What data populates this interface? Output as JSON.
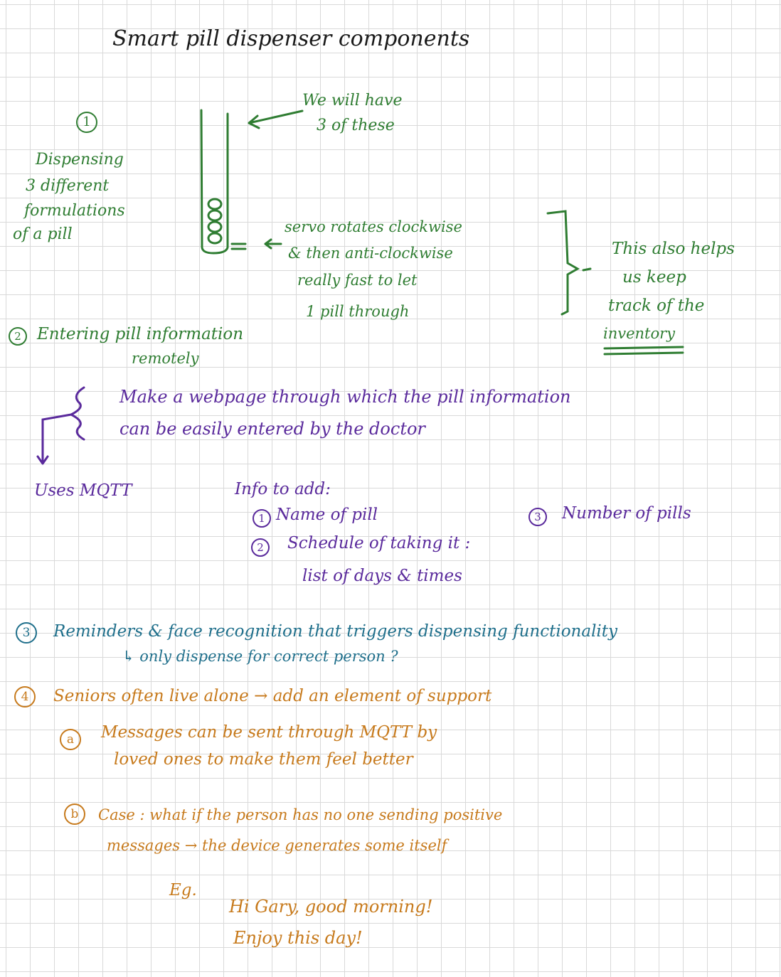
{
  "title": "Smart pill dispenser components",
  "sec1": {
    "num": "1",
    "label": [
      "Dispensing",
      "3 different",
      "formulations",
      "of a pill"
    ],
    "have_note": [
      "We will have",
      "3 of these"
    ],
    "servo_note": [
      "servo rotates clockwise",
      "& then anti-clockwise",
      "really fast  to let",
      "1 pill through"
    ],
    "inventory_note": [
      "This also helps",
      "us keep",
      "track of the",
      "inventory"
    ]
  },
  "sec2": {
    "num": "2",
    "heading": [
      "Entering pill information",
      "remotely"
    ],
    "webpage": [
      "Make  a  webpage  through  which  the  pill  information",
      "can  be  easily  entered  by  the  doctor"
    ],
    "mqtt": "Uses MQTT",
    "info_title": "Info to add:",
    "item1_num": "1",
    "item1": "Name of pill",
    "item2_num": "2",
    "item2": [
      "Schedule  of  taking  it :",
      "list of  days &    times"
    ],
    "item3_num": "3",
    "item3": "Number of pills"
  },
  "sec3": {
    "num": "3",
    "line1": "Reminders  &  face  recognition  that  triggers  dispensing  functionality",
    "line2": "↳ only  dispense  for  correct  person ?"
  },
  "sec4": {
    "num": "4",
    "line1": "Seniors  often  live  alone  →  add  an  element  of  support",
    "a_letter": "a",
    "a_text": [
      "Messages    can   be   sent    through  MQTT  by",
      "loved  ones     to make   them   feel  better"
    ],
    "b_letter": "b",
    "b_text": [
      "Case : what  if  the   person  has  no one  sending  positive",
      "messages  →  the  device  generates   some  itself"
    ],
    "eg_label": "Eg.",
    "eg_text": [
      "Hi  Gary,  good  morning!",
      "Enjoy    this  day!"
    ]
  },
  "colors": {
    "title": "#1a1a1a",
    "section1": "#2f7d32",
    "section2_list": "#5a2a9c",
    "section3": "#1f6f8b",
    "section4": "#c77a1c",
    "grid": "#d9d9d9"
  }
}
